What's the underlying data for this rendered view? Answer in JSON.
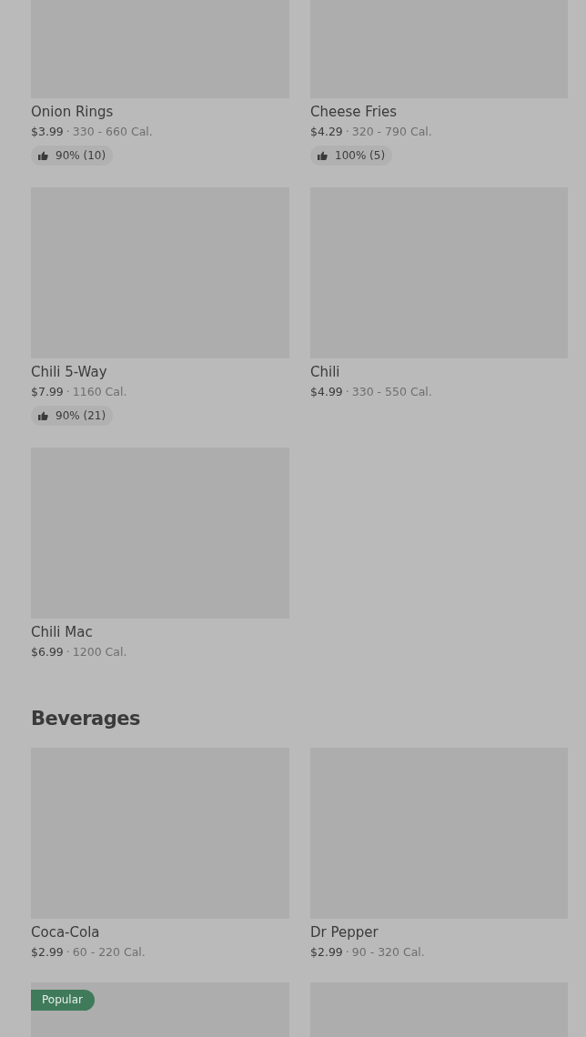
{
  "sections": [
    {
      "items": [
        {
          "kind": "card",
          "name": "Onion Rings",
          "price": "$3.99",
          "separator": "·",
          "calories": "330 - 660 Cal.",
          "rating": "90% (10)"
        },
        {
          "kind": "card",
          "name": "Cheese Fries",
          "price": "$4.29",
          "separator": "·",
          "calories": "320 - 790 Cal.",
          "rating": "100% (5)"
        },
        {
          "kind": "card",
          "name": "Chili 5-Way",
          "price": "$7.99",
          "separator": "·",
          "calories": "1160 Cal.",
          "rating": "90% (21)"
        },
        {
          "kind": "card",
          "name": "Chili",
          "price": "$4.99",
          "separator": "·",
          "calories": "330 - 550 Cal."
        },
        {
          "kind": "card",
          "name": "Chili Mac",
          "price": "$6.99",
          "separator": "·",
          "calories": "1200 Cal."
        }
      ]
    },
    {
      "title": "Beverages",
      "items": [
        {
          "kind": "card",
          "name": "Coca-Cola",
          "price": "$2.99",
          "separator": "·",
          "calories": "60 - 220 Cal."
        },
        {
          "kind": "card",
          "name": "Dr Pepper",
          "price": "$2.99",
          "separator": "·",
          "calories": "90 - 320 Cal."
        },
        {
          "kind": "image",
          "badge": "Popular"
        },
        {
          "kind": "image"
        }
      ]
    }
  ]
}
